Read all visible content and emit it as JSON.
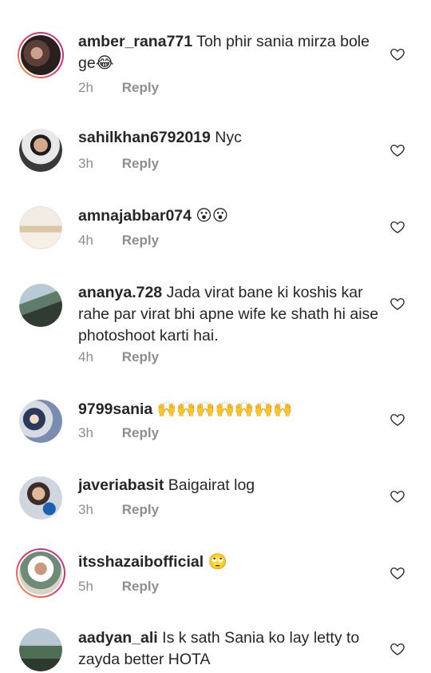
{
  "reply_label": "Reply",
  "comments": [
    {
      "username": "amber_rana771",
      "text": "Toh phir sania mirza bole ge😂",
      "time": "2h"
    },
    {
      "username": "sahilkhan6792019",
      "text": "Nyc",
      "time": "3h"
    },
    {
      "username": "amnajabbar074",
      "text": "😮😮",
      "time": "4h"
    },
    {
      "username": "ananya.728",
      "text": "Jada virat bane ki koshis kar rahe par virat bhi apne wife ke shath hi aise photoshoot karti hai.",
      "time": "4h"
    },
    {
      "username": "9799sania",
      "text": "🙌🙌🙌🙌🙌🙌🙌",
      "time": "3h"
    },
    {
      "username": "javeriabasit",
      "text": "Baigairat log",
      "time": "3h"
    },
    {
      "username": "itsshazaibofficial",
      "text": "🙄",
      "time": "5h"
    },
    {
      "username": "aadyan_ali",
      "text": "Is k  sath Sania ko lay letty to zayda better HOTA",
      "time": ""
    }
  ],
  "colors": {
    "text": "#262626",
    "muted": "#8e8e8e",
    "ring_start": "#f9a13a",
    "ring_end": "#c13584"
  }
}
